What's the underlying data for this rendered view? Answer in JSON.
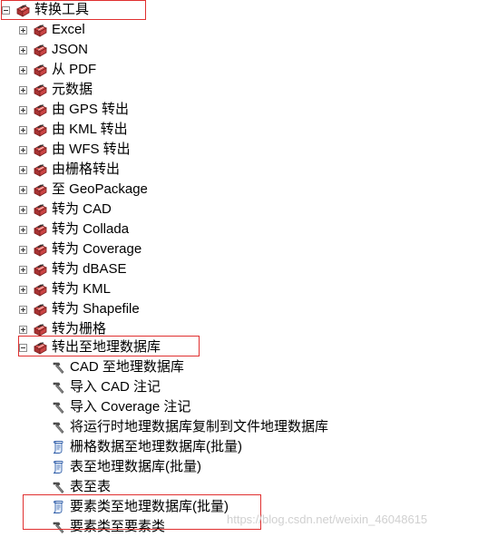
{
  "root": {
    "label": "转换工具"
  },
  "toolsets": [
    {
      "label": "Excel"
    },
    {
      "label": "JSON"
    },
    {
      "label": "从 PDF"
    },
    {
      "label": "元数据"
    },
    {
      "label": "由 GPS 转出"
    },
    {
      "label": "由 KML 转出"
    },
    {
      "label": "由 WFS 转出"
    },
    {
      "label": "由栅格转出"
    },
    {
      "label": "至 GeoPackage"
    },
    {
      "label": "转为 CAD"
    },
    {
      "label": "转为 Collada"
    },
    {
      "label": "转为 Coverage"
    },
    {
      "label": "转为 dBASE"
    },
    {
      "label": "转为 KML"
    },
    {
      "label": "转为 Shapefile"
    },
    {
      "label": "转为栅格"
    }
  ],
  "expanded_toolset": {
    "label": "转出至地理数据库",
    "tools": [
      {
        "label": "CAD 至地理数据库",
        "icon": "hammer-icon"
      },
      {
        "label": "导入 CAD 注记",
        "icon": "hammer-icon"
      },
      {
        "label": "导入 Coverage 注记",
        "icon": "hammer-icon"
      },
      {
        "label": "将运行时地理数据库复制到文件地理数据库",
        "icon": "hammer-icon"
      },
      {
        "label": "栅格数据至地理数据库(批量)",
        "icon": "script-icon"
      },
      {
        "label": "表至地理数据库(批量)",
        "icon": "script-icon"
      },
      {
        "label": "表至表",
        "icon": "hammer-icon"
      },
      {
        "label": "要素类至地理数据库(批量)",
        "icon": "script-icon"
      },
      {
        "label": "要素类至要素类",
        "icon": "hammer-icon"
      }
    ]
  },
  "watermark": "https://blog.csdn.net/weixin_46048615",
  "colors": {
    "highlight_border": "#e03030",
    "toolbox_red": "#b22222"
  }
}
